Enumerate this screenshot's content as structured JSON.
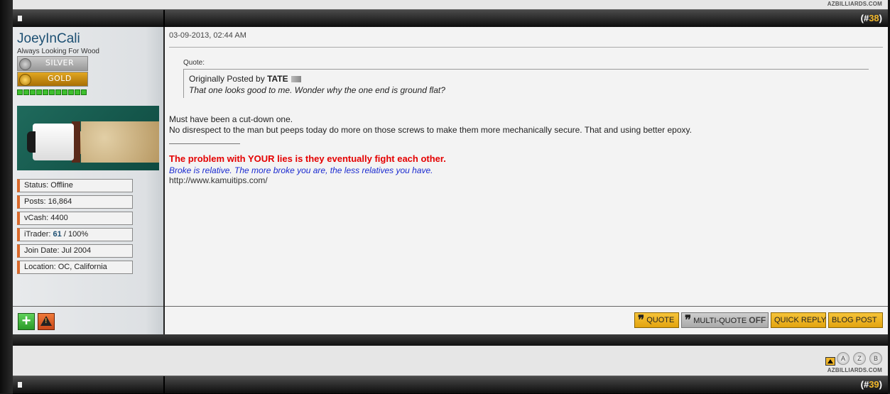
{
  "brand": "AZBILLIARDS.COM",
  "post": {
    "number_prefix": "(#",
    "number": "38",
    "number_suffix": ")",
    "date": "03-09-2013, 02:44 AM",
    "user": {
      "name": "JoeyInCali",
      "title": "Always Looking For Wood",
      "ranks": [
        "SILVER",
        "GOLD"
      ],
      "reputation_pips": 11,
      "stats": [
        {
          "label": "Status: Offline"
        },
        {
          "label": "Posts: 16,864"
        },
        {
          "label": "vCash: 4400"
        },
        {
          "label_prefix": "iTrader: ",
          "value": "61",
          "suffix": " / 100%"
        },
        {
          "label": "Join Date: Jul 2004"
        },
        {
          "label": "Location: OC, California"
        }
      ]
    },
    "quote": {
      "label": "Quote:",
      "originally_posted_by": "Originally Posted by ",
      "author": "TATE",
      "text": "That one looks good to me. Wonder why the one end is ground flat?"
    },
    "message": [
      "Must have been a cut-down one.",
      "No disrespect to the man but peeps today do more on those screws to make them more mechanically secure. That and using better epoxy."
    ],
    "signature": {
      "line1": "The problem with YOUR lies is they eventually fight each other.",
      "line2": "Broke is relative. The more broke you are, the less relatives you have.",
      "line3": "http://www.kamuitips.com/"
    },
    "buttons": {
      "quote": "QUOTE",
      "multi_quote": "MULTI-QUOTE",
      "multi_quote_state": "OFF",
      "quick_reply": "QUICK REPLY",
      "blog_post": "BLOG POST"
    },
    "colors": {
      "accent_orange": "#f0b62a",
      "username": "#1c4f72",
      "signature_red": "#e40000",
      "signature_blue": "#1a2ad0"
    }
  },
  "nav_letters": [
    "A",
    "Z",
    "B"
  ],
  "next_post": {
    "number_prefix": "(#",
    "number": "39",
    "number_suffix": ")"
  }
}
